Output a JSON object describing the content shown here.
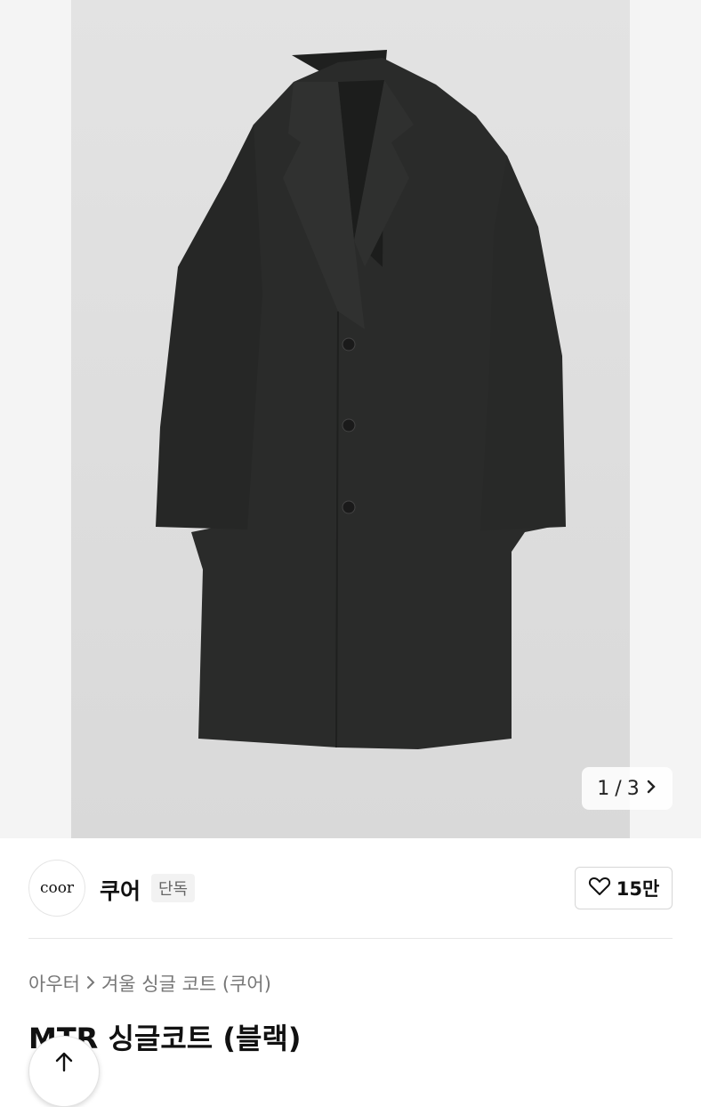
{
  "gallery": {
    "counter_current": "1",
    "counter_sep": "/",
    "counter_total": "3",
    "next_icon": "chevron-right-icon"
  },
  "brand": {
    "logo_text": "coor",
    "name": "쿠어",
    "badge": "단독",
    "like_icon": "heart-outline-icon",
    "like_count": "15만"
  },
  "breadcrumb": {
    "category": "아우터",
    "subcategory": "겨울 싱글 코트 (쿠어)"
  },
  "product": {
    "title": "MTR 싱글코트 (블랙)"
  },
  "colors": {
    "coat": "#2a2b2a",
    "photo_bg": "#e0e0e0"
  }
}
